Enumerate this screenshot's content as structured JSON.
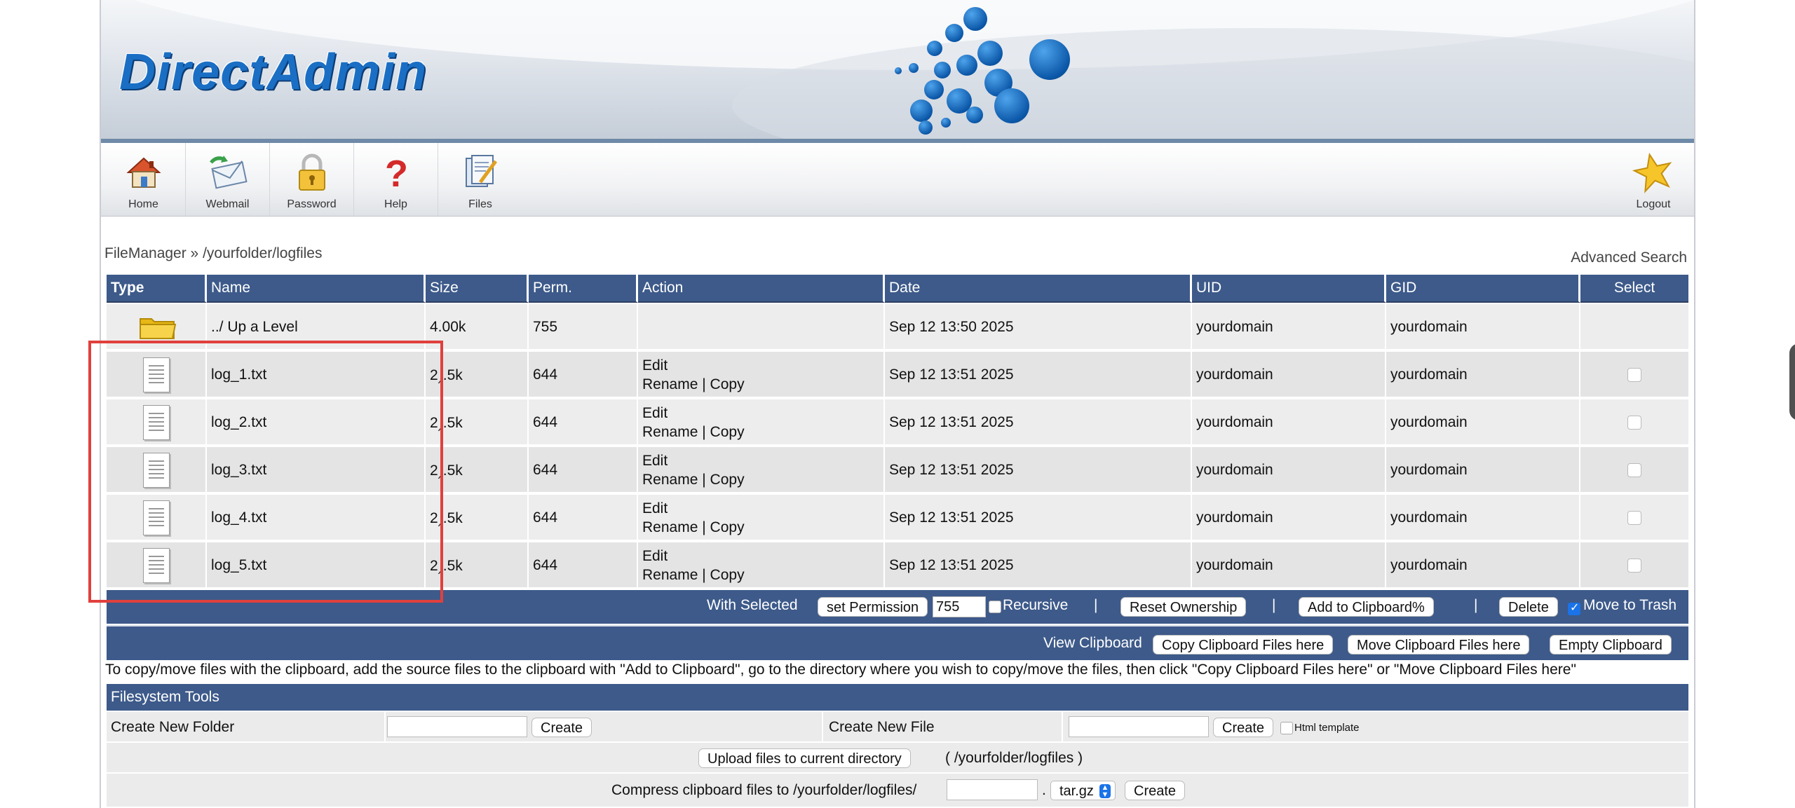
{
  "brand": {
    "logo_text": "DirectAdmin",
    "accent": "#3d5a8a",
    "logo_color": "#1a6fc4"
  },
  "toolbar": {
    "items": [
      {
        "label": "Home",
        "icon": "home-icon"
      },
      {
        "label": "Webmail",
        "icon": "mail-icon"
      },
      {
        "label": "Password",
        "icon": "lock-icon"
      },
      {
        "label": "Help",
        "icon": "help-icon"
      },
      {
        "label": "Files",
        "icon": "files-icon"
      }
    ],
    "logout_label": "Logout"
  },
  "breadcrumb": "FileManager » /yourfolder/logfiles",
  "advanced_search": "Advanced Search",
  "table": {
    "headers": [
      "Type",
      "Name",
      "Size",
      "Perm.",
      "Action",
      "Date",
      "UID",
      "GID",
      "Select"
    ],
    "up_row": {
      "name": "../ Up a Level",
      "size": "4.00k",
      "perm": "755",
      "date": "Sep 12 13:50 2025",
      "uid": "yourdomain",
      "gid": "yourdomain"
    },
    "rows": [
      {
        "name": "log_1.txt",
        "size": "2‸.5k",
        "perm": "644",
        "edit": "Edit",
        "rename": "Rename",
        "sep": "|",
        "copy": "Copy",
        "date": "Sep 12 13:51 2025",
        "uid": "yourdomain",
        "gid": "yourdomain"
      },
      {
        "name": "log_2.txt",
        "size": "2‸.5k",
        "perm": "644",
        "edit": "Edit",
        "rename": "Rename",
        "sep": "|",
        "copy": "Copy",
        "date": "Sep 12 13:51 2025",
        "uid": "yourdomain",
        "gid": "yourdomain"
      },
      {
        "name": "log_3.txt",
        "size": "2‸.5k",
        "perm": "644",
        "edit": "Edit",
        "rename": "Rename",
        "sep": "|",
        "copy": "Copy",
        "date": "Sep 12 13:51 2025",
        "uid": "yourdomain",
        "gid": "yourdomain"
      },
      {
        "name": "log_4.txt",
        "size": "2‸.5k",
        "perm": "644",
        "edit": "Edit",
        "rename": "Rename",
        "sep": "|",
        "copy": "Copy",
        "date": "Sep 12 13:51 2025",
        "uid": "yourdomain",
        "gid": "yourdomain"
      },
      {
        "name": "log_5.txt",
        "size": "2‸.5k",
        "perm": "644",
        "edit": "Edit",
        "rename": "Rename",
        "sep": "|",
        "copy": "Copy",
        "date": "Sep 12 13:51 2025",
        "uid": "yourdomain",
        "gid": "yourdomain"
      }
    ]
  },
  "with_selected": {
    "label": "With Selected",
    "set_permission": "set Permission",
    "perm_value": "755",
    "recursive": "Recursive",
    "sep": "|",
    "reset_ownership": "Reset Ownership",
    "add_to_clipboard": "Add to Clipboard%",
    "delete": "Delete",
    "move_to_trash": "Move to Trash"
  },
  "clipboard": {
    "view": "View Clipboard",
    "copy_here": "Copy Clipboard Files here",
    "move_here": "Move Clipboard Files here",
    "empty": "Empty Clipboard"
  },
  "info_text": "To copy/move files with the clipboard, add the source files to the clipboard with \"Add to Clipboard\", go to the directory where you wish to copy/move the files, then click \"Copy Clipboard Files here\" or \"Move Clipboard Files here\"",
  "fs_tools": {
    "title": "Filesystem Tools",
    "create_folder": "Create New Folder",
    "create_btn": "Create",
    "create_file": "Create New File",
    "html_template": "Html template",
    "upload_btn": "Upload files to current directory",
    "upload_path": "( /yourfolder/logfiles )",
    "compress_label": "Compress clipboard files to /yourfolder/logfiles/",
    "dot": ".",
    "ext": "tar.gz"
  }
}
